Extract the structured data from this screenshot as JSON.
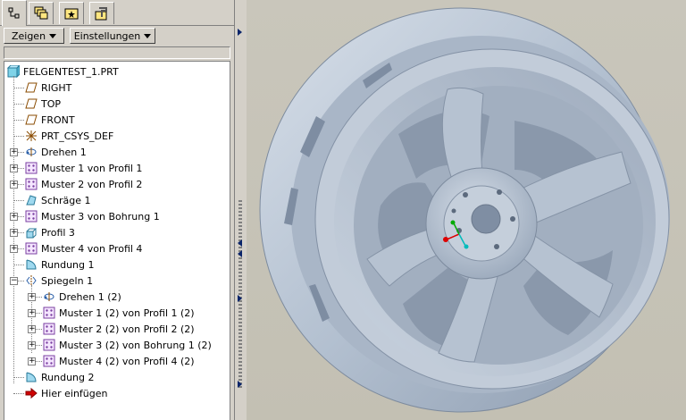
{
  "tabs": [
    {
      "icon": "model-tree-icon"
    },
    {
      "icon": "layers-icon"
    },
    {
      "icon": "favorites-icon"
    },
    {
      "icon": "tools-icon"
    }
  ],
  "toolbar": {
    "show_label": "Zeigen",
    "settings_label": "Einstellungen"
  },
  "tree": {
    "root": "FELGENTEST_1.PRT",
    "items": [
      {
        "label": "RIGHT",
        "icon": "datum-plane-icon",
        "expandable": false
      },
      {
        "label": "TOP",
        "icon": "datum-plane-icon",
        "expandable": false
      },
      {
        "label": "FRONT",
        "icon": "datum-plane-icon",
        "expandable": false
      },
      {
        "label": "PRT_CSYS_DEF",
        "icon": "csys-icon",
        "expandable": false
      },
      {
        "label": "Drehen 1",
        "icon": "revolve-icon",
        "expandable": true
      },
      {
        "label": "Muster 1 von Profil 1",
        "icon": "pattern-icon",
        "expandable": true
      },
      {
        "label": "Muster 2 von Profil 2",
        "icon": "pattern-icon",
        "expandable": true
      },
      {
        "label": "Schräge 1",
        "icon": "draft-icon",
        "expandable": false
      },
      {
        "label": "Muster 3 von Bohrung 1",
        "icon": "pattern-icon",
        "expandable": true
      },
      {
        "label": "Profil 3",
        "icon": "extrude-icon",
        "expandable": true
      },
      {
        "label": "Muster 4 von Profil 4",
        "icon": "pattern-icon",
        "expandable": true
      },
      {
        "label": "Rundung 1",
        "icon": "round-icon",
        "expandable": false
      },
      {
        "label": "Spiegeln 1",
        "icon": "mirror-icon",
        "expandable": true
      },
      {
        "label": "Drehen 1 (2)",
        "icon": "revolve-icon",
        "expandable": true,
        "child": true
      },
      {
        "label": "Muster 1 (2) von Profil 1 (2)",
        "icon": "pattern-icon",
        "expandable": true,
        "child": true
      },
      {
        "label": "Muster 2 (2) von Profil 2 (2)",
        "icon": "pattern-icon",
        "expandable": true,
        "child": true
      },
      {
        "label": "Muster 3 (2) von Bohrung 1 (2)",
        "icon": "pattern-icon",
        "expandable": true,
        "child": true
      },
      {
        "label": "Muster 4 (2) von Profil 4 (2)",
        "icon": "pattern-icon",
        "expandable": true,
        "child": true
      },
      {
        "label": "Rundung 2",
        "icon": "round-icon",
        "expandable": false
      },
      {
        "label": "Hier einfügen",
        "icon": "insert-here-icon",
        "expandable": false
      }
    ]
  },
  "colors": {
    "wheel": "#b4c1d2",
    "tree_bg": "#ffffff",
    "panel": "#d4d0c8",
    "viewport_bg": "#c6c3b7"
  }
}
